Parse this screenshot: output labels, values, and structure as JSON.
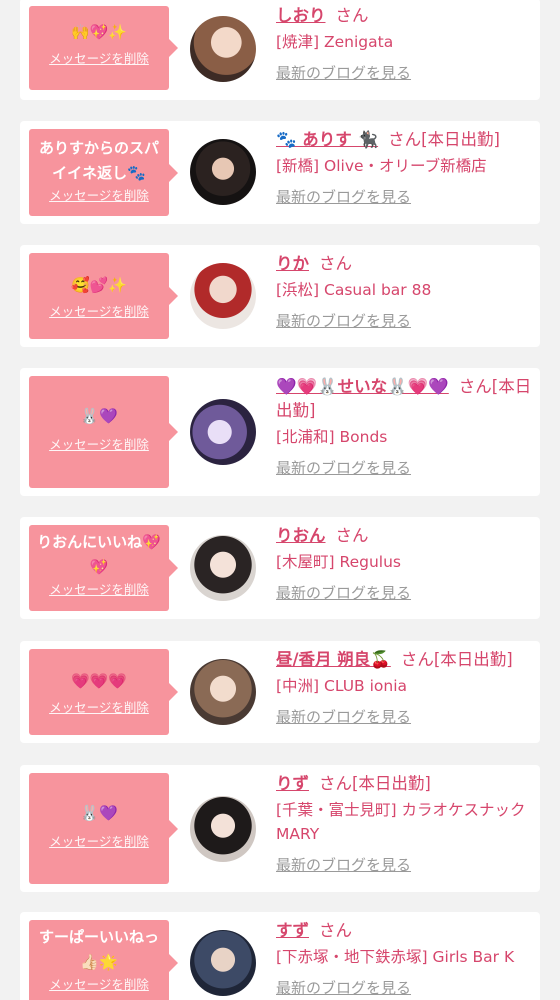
{
  "delete_label": "メッセージを削除",
  "san_label": "さん",
  "blog_label": "最新のブログを見る",
  "colors": {
    "background": "#f2f2f2",
    "card": "#ffffff",
    "bubble": "#f7949d",
    "accent": "#d6466c",
    "link_gray": "#9a9a9a"
  },
  "items": [
    {
      "message": "🙌💖✨",
      "name": "しおり",
      "status": "",
      "shop": "[焼津] Zenigata",
      "avatar_icon": "avatar-photo"
    },
    {
      "message": "ありすからのスパイイネ返し🐾",
      "name": "🐾 ありす 🐈‍⬛",
      "status": "[本日出勤]",
      "shop": "[新橋] Olive・オリーブ新橋店",
      "avatar_icon": "avatar-photo"
    },
    {
      "message": "🥰💕✨",
      "name": "りか",
      "status": "",
      "shop": "[浜松] Casual bar 88",
      "avatar_icon": "avatar-photo"
    },
    {
      "message": "🐰💜",
      "name": "💜💗🐰せいな🐰💗💜",
      "status": "[本日出勤]",
      "shop": "[北浦和] Bonds",
      "avatar_icon": "avatar-photo"
    },
    {
      "message": "りおんにいいね💖💖",
      "name": "りおん",
      "status": "",
      "shop": "[木屋町] Regulus",
      "avatar_icon": "avatar-photo"
    },
    {
      "message": "💗💗💗",
      "name": "昼/香月 朔良🍒",
      "status": "[本日出勤]",
      "shop": "[中洲] CLUB ionia",
      "avatar_icon": "avatar-photo"
    },
    {
      "message": "🐰💜",
      "name": "りず",
      "status": "[本日出勤]",
      "shop": "[千葉・富士見町] カラオケスナック MARY",
      "avatar_icon": "avatar-photo"
    },
    {
      "message": "すーぱーいいねっ👍🏻🌟",
      "name": "すず",
      "status": "",
      "shop": "[下赤塚・地下鉄赤塚] Girls Bar K",
      "avatar_icon": "avatar-photo"
    }
  ]
}
